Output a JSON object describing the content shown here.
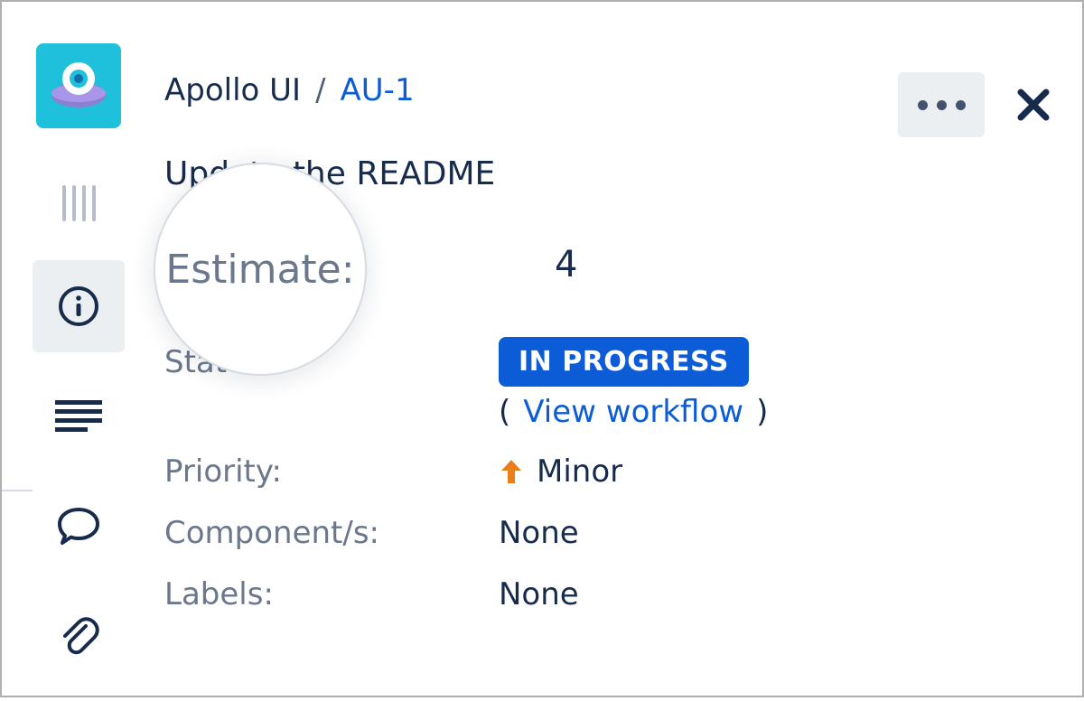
{
  "breadcrumb": {
    "project": "Apollo UI",
    "issue_key": "AU-1"
  },
  "issue": {
    "title": "Update the README"
  },
  "lens": {
    "label": "Estimate:",
    "value": "4",
    "obscured_fragment": "D . t . t"
  },
  "fields": {
    "status_label": "Status:",
    "status_value": "IN PROGRESS",
    "view_workflow": "View workflow",
    "priority_label": "Priority:",
    "priority_value": "Minor",
    "components_label": "Component/s:",
    "components_value": "None",
    "labels_label": "Labels:",
    "labels_value": "None"
  }
}
